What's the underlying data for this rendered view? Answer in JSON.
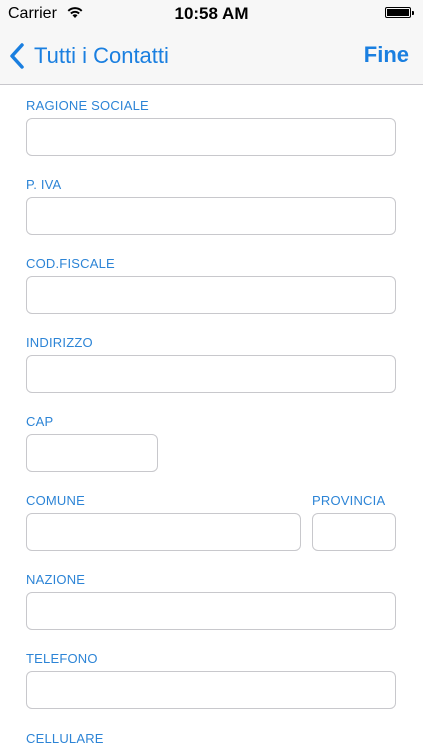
{
  "status": {
    "carrier": "Carrier",
    "time": "10:58 AM"
  },
  "nav": {
    "back_label": "Tutti i Contatti",
    "done_label": "Fine"
  },
  "form": {
    "ragione_sociale": {
      "label": "RAGIONE SOCIALE",
      "value": ""
    },
    "piva": {
      "label": "P. IVA",
      "value": ""
    },
    "cod_fiscale": {
      "label": "COD.FISCALE",
      "value": ""
    },
    "indirizzo": {
      "label": "INDIRIZZO",
      "value": ""
    },
    "cap": {
      "label": "CAP",
      "value": ""
    },
    "comune": {
      "label": "COMUNE",
      "value": ""
    },
    "provincia": {
      "label": "PROVINCIA",
      "value": ""
    },
    "nazione": {
      "label": "NAZIONE",
      "value": ""
    },
    "telefono": {
      "label": "TELEFONO",
      "value": ""
    },
    "cellulare": {
      "label": "CELLULARE"
    }
  },
  "colors": {
    "accent": "#1a7fe0",
    "label": "#2c84d6",
    "field_border": "#c8c8cc",
    "bar_background": "#f7f7f7"
  }
}
